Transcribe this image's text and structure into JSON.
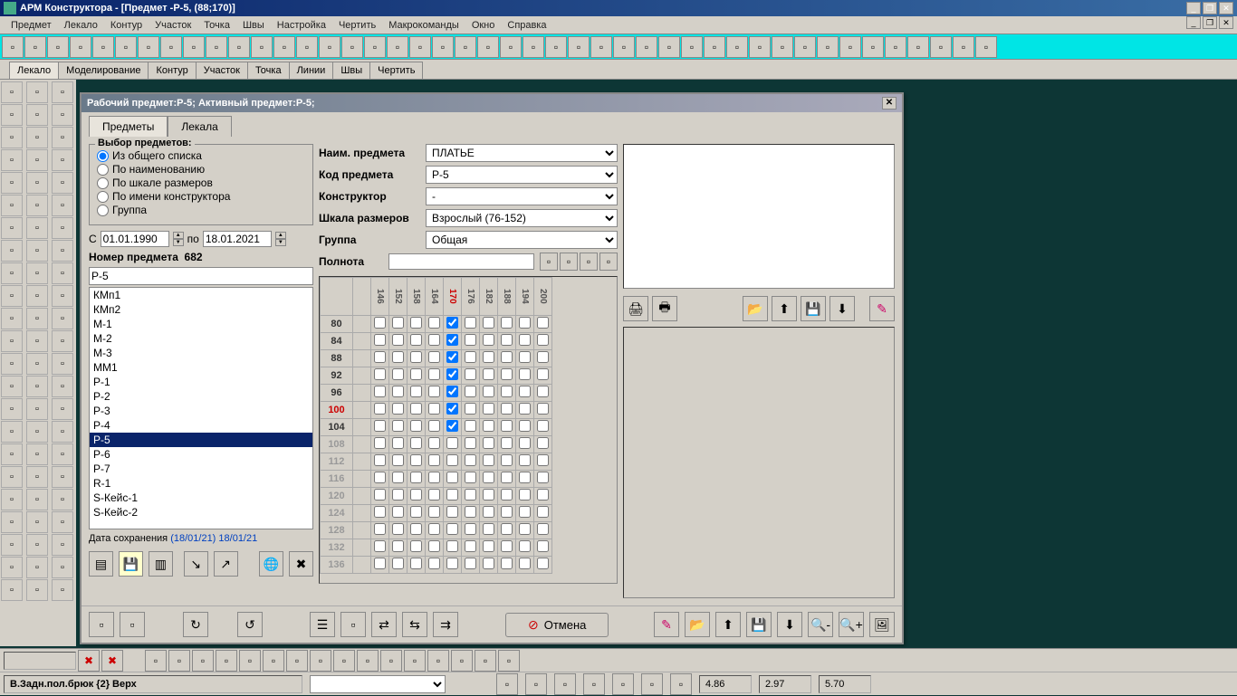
{
  "title": "АРМ Конструктора - [Предмет -P-5,  (88;170)]",
  "menu": [
    "Предмет",
    "Лекало",
    "Контур",
    "Участок",
    "Точка",
    "Швы",
    "Настройка",
    "Чертить",
    "Макрокоманды",
    "Окно",
    "Справка"
  ],
  "maintabs": [
    "Лекало",
    "Моделирование",
    "Контур",
    "Участок",
    "Точка",
    "Линии",
    "Швы",
    "Чертить"
  ],
  "maintab_active": 0,
  "dialog": {
    "title": "Рабочий предмет:P-5;  Активный предмет:P-5;",
    "tabs": [
      "Предметы",
      "Лекала"
    ],
    "tab_active": 0,
    "selection": {
      "title": "Выбор предметов:",
      "options": [
        "Из общего списка",
        "По наименованию",
        "По шкале размеров",
        "По имени конструктора",
        "Группа"
      ],
      "selected": 0
    },
    "date_from_lbl": "С",
    "date_from": "01.01.1990",
    "date_to_lbl": "по",
    "date_to": "18.01.2021",
    "item_count_lbl": "Номер предмета",
    "item_count": "682",
    "search": "P-5",
    "list": [
      "КМп1",
      "КМп2",
      "М-1",
      "М-2",
      "М-3",
      "ММ1",
      "Р-1",
      "Р-2",
      "Р-3",
      "Р-4",
      "Р-5",
      "Р-6",
      "Р-7",
      "R-1",
      "S-Кейс-1",
      "S-Кейс-2"
    ],
    "list_selected": 10,
    "save_date_lbl": "Дата сохранения",
    "save_date_val": "(18/01/21) 18/01/21",
    "form": {
      "name_lbl": "Наим. предмета",
      "name_val": "ПЛАТЬЕ",
      "code_lbl": "Код предмета",
      "code_val": "P-5",
      "constr_lbl": "Конструктор",
      "constr_val": "-",
      "scale_lbl": "Шкала размеров",
      "scale_val": "Взрослый (76-152)",
      "group_lbl": "Группа",
      "group_val": "Общая",
      "fullness_lbl": "Полнота",
      "fullness_val": ""
    },
    "grid": {
      "cols": [
        "146",
        "152",
        "158",
        "164",
        "170",
        "176",
        "182",
        "188",
        "194",
        "200"
      ],
      "col_hl": 4,
      "rows": [
        "80",
        "84",
        "88",
        "92",
        "96",
        "100",
        "104",
        "108",
        "112",
        "116",
        "120",
        "124",
        "128",
        "132",
        "136"
      ],
      "row_hl": 5,
      "gray_from": 7,
      "checked_rows": [
        0,
        1,
        2,
        3,
        4,
        5,
        6
      ],
      "checked_col": 4
    },
    "cancel": "Отмена"
  },
  "status": {
    "text": "В.Задн.пол.брюк {2} Верх",
    "val1": "4.86",
    "val2": "2.97",
    "val3": "5.70"
  }
}
